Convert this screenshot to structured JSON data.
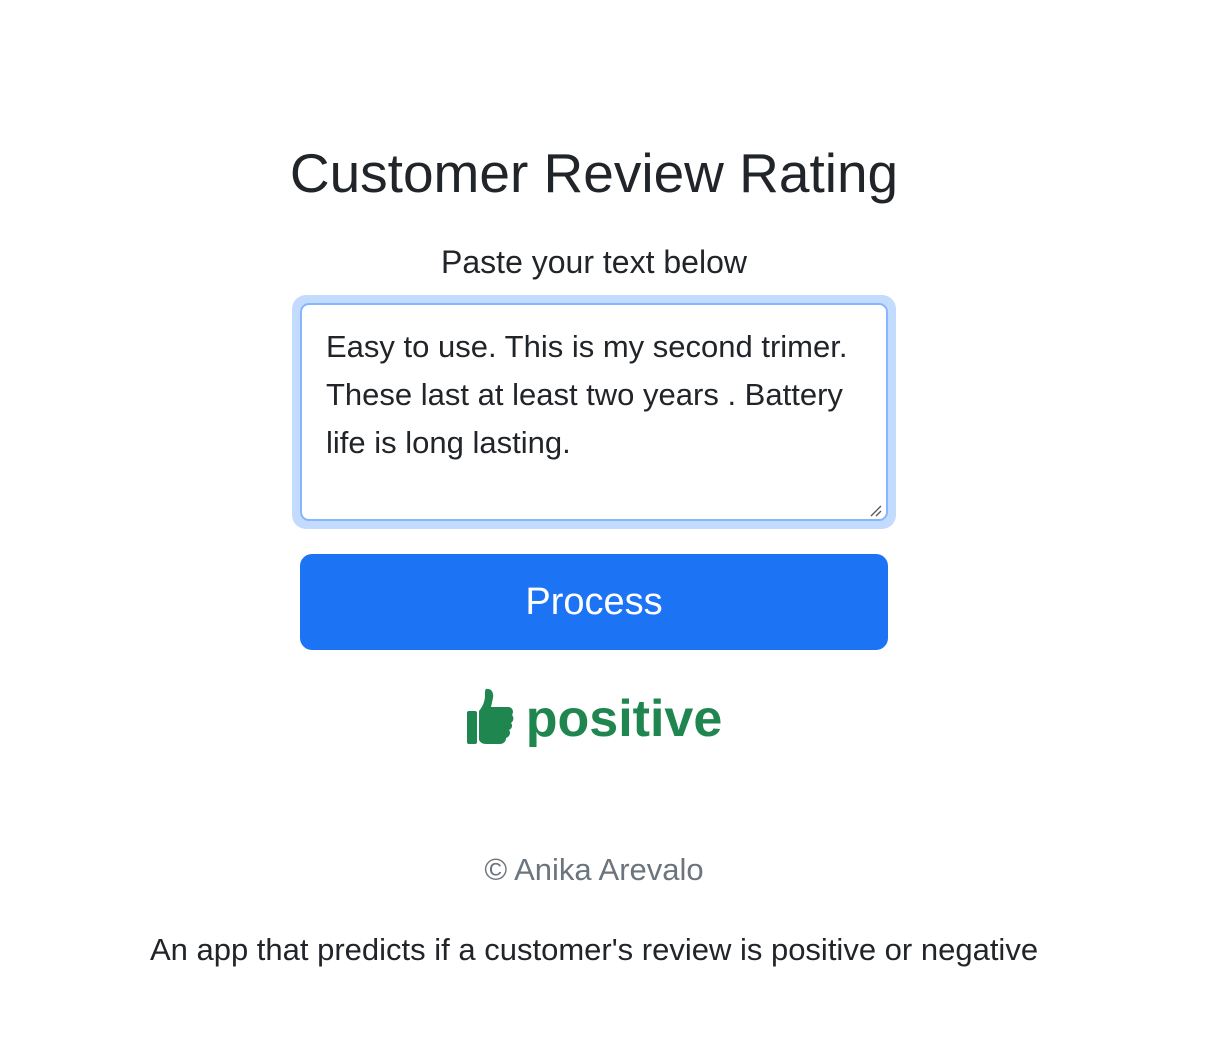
{
  "header": {
    "title": "Customer Review Rating",
    "subtitle": "Paste your text below"
  },
  "form": {
    "review_text": "Easy to use. This is my second trimer. These last at least two years . Battery life is long lasting.",
    "process_label": "Process"
  },
  "result": {
    "icon": "thumbs-up-icon",
    "label": "positive",
    "color": "#20864f"
  },
  "footer": {
    "copyright": "© Anika Arevalo",
    "description": "An app that predicts if a customer's review is positive or negative"
  },
  "colors": {
    "primary": "#1c74f5",
    "focus_ring": "#c2dbfe",
    "focus_border": "#86b7fe",
    "text": "#212529",
    "muted": "#6c757d",
    "success": "#20864f"
  }
}
